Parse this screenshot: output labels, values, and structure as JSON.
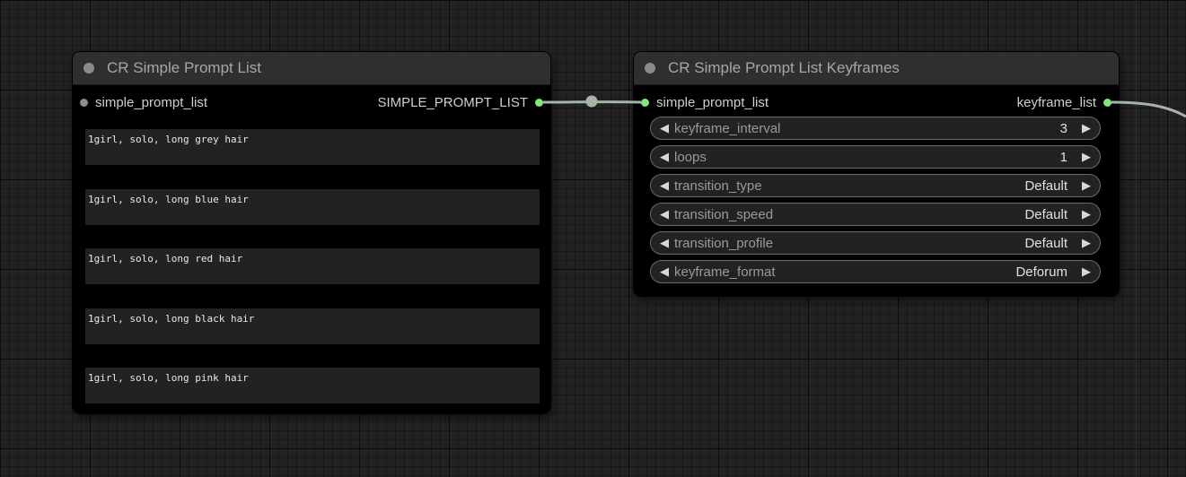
{
  "colors": {
    "canvas_bg": "#222222",
    "node_bg": "#353535",
    "node_body": "#000000",
    "link": "#a5b4a6",
    "slot_green": "#82e67a",
    "slot_grey": "#8c8c8c"
  },
  "node_prompt_list": {
    "title": "CR Simple Prompt List",
    "input_label": "simple_prompt_list",
    "output_label": "SIMPLE_PROMPT_LIST",
    "prompts": [
      "1girl, solo, long grey hair",
      "1girl, solo, long blue hair",
      "1girl, solo, long red hair",
      "1girl, solo, long black hair",
      "1girl, solo, long pink hair"
    ]
  },
  "node_keyframes": {
    "title": "CR Simple Prompt List Keyframes",
    "input_label": "simple_prompt_list",
    "output_label": "keyframe_list",
    "widgets": [
      {
        "label": "keyframe_interval",
        "value": "3"
      },
      {
        "label": "loops",
        "value": "1"
      },
      {
        "label": "transition_type",
        "value": "Default"
      },
      {
        "label": "transition_speed",
        "value": "Default"
      },
      {
        "label": "transition_profile",
        "value": "Default"
      },
      {
        "label": "keyframe_format",
        "value": "Deforum"
      }
    ]
  },
  "icons": {
    "left_arrow": "◀",
    "right_arrow": "▶"
  }
}
